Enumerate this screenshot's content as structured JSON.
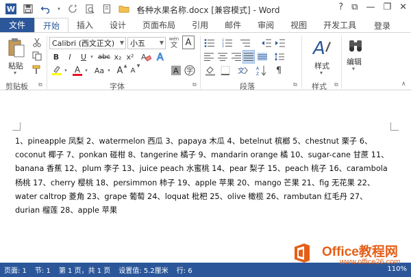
{
  "window": {
    "title": "各种水果名称.docx [兼容模式] - Word",
    "controls": {
      "help": "?",
      "ribbon_options": "⧉",
      "minimize": "—",
      "restore": "❐",
      "close": "✕"
    }
  },
  "tabs": {
    "file": "文件",
    "items": [
      "开始",
      "插入",
      "设计",
      "页面布局",
      "引用",
      "邮件",
      "审阅",
      "视图",
      "开发工具"
    ],
    "active": "开始",
    "login": "登录"
  },
  "ribbon": {
    "clipboard": {
      "paste": "粘贴",
      "label": "剪贴板"
    },
    "font": {
      "font_name": "Calibri (西文正文)",
      "font_size": "小五",
      "wen": "wén",
      "A_big": "A",
      "bold": "B",
      "italic": "I",
      "underline": "U",
      "strike": "abc",
      "sub": "x₂",
      "sup": "x²",
      "font_color": "A",
      "aa": "Aa",
      "grow": "A",
      "shrink": "A",
      "label": "字体"
    },
    "paragraph": {
      "label": "段落"
    },
    "styles": {
      "button": "样式",
      "label": "样式"
    },
    "editing": {
      "button": "编辑"
    }
  },
  "document": {
    "text": "1、pineapple 凤梨 2、watermelon 西瓜 3、papaya 木瓜 4、betelnut 槟榔 5、chestnut 栗子 6、coconut 椰子 7、ponkan 碰柑 8、tangerine 橘子 9、mandarin orange 橘 10、sugar-cane 甘蔗 11、banana 香蕉 12、plum 李子 13、juice peach 水蜜桃 14、pear 梨子 15、peach 桃子 16、carambola 杨桃 17、cherry 樱桃 18、persimmon 柿子 19、apple 苹果 20、mango 芒果 21、fig 无花果 22、water caltrop 菱角 23、grape 葡萄 24、loquat 枇杷 25、olive 橄榄 26、rambutan 红毛丹 27、durian 榴莲 28、apple 苹果"
  },
  "status": {
    "page": "页面: 1",
    "section": "节: 1",
    "page_of": "第 1 页，共 1 页",
    "position": "设置值: 5.2厘米",
    "line": "行: 6",
    "zoom": "110%"
  },
  "watermark": {
    "name": "Office教程网",
    "url": "www.office26.com"
  },
  "colors": {
    "accent": "#2b579a",
    "watermark": "#e55e16",
    "font_red": "#e81123",
    "highlight": "#ffff00"
  }
}
